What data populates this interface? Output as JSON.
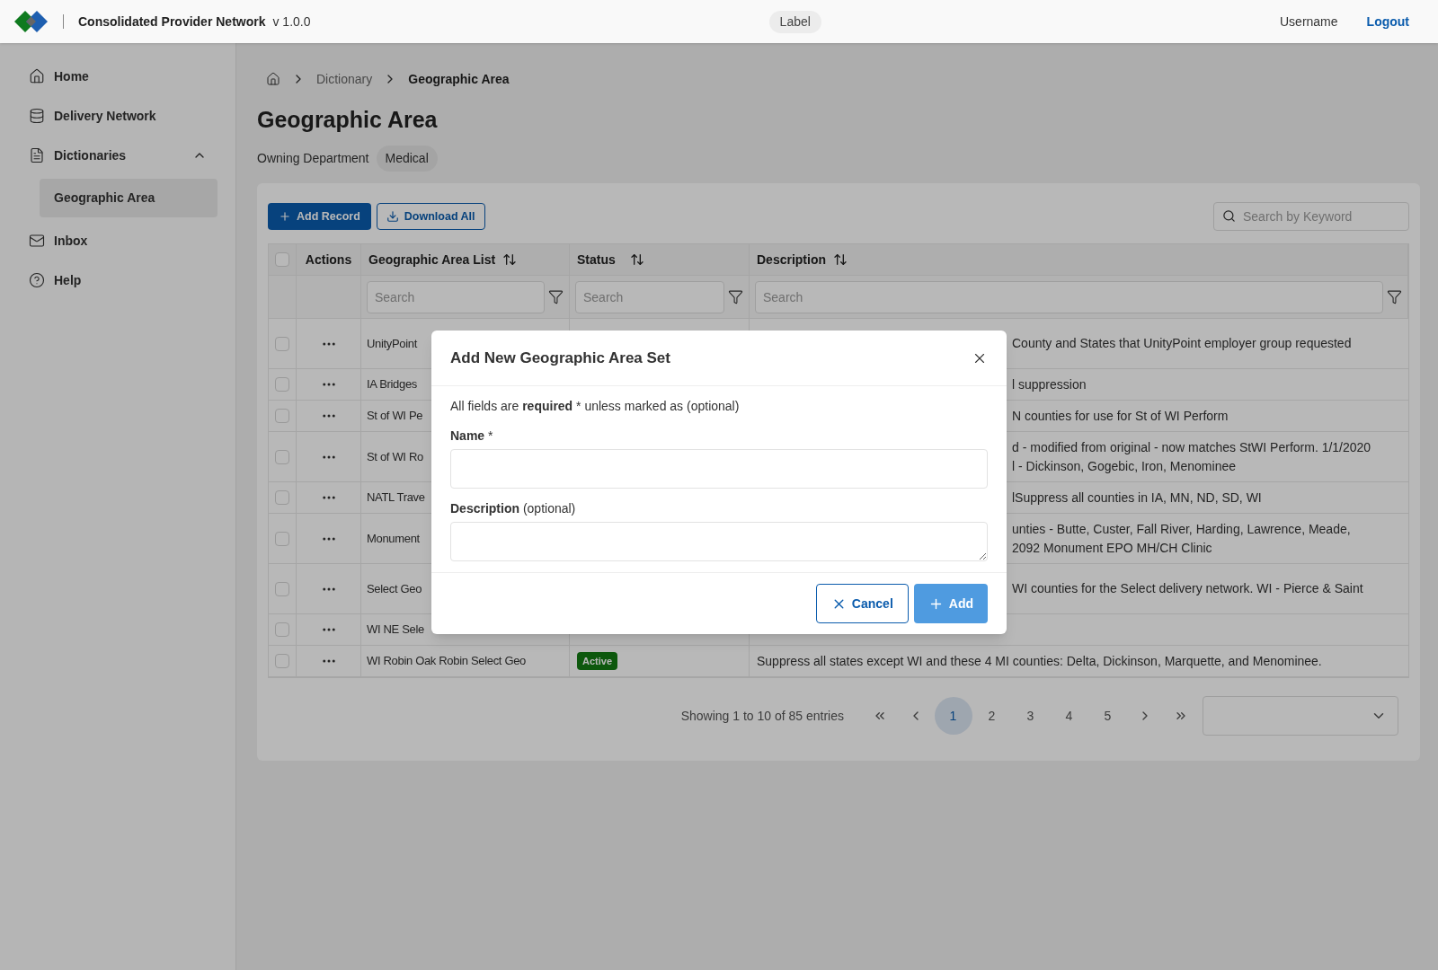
{
  "header": {
    "title": "Consolidated Provider Network",
    "version": "v 1.0.0",
    "label": "Label",
    "username": "Username",
    "logout": "Logout"
  },
  "sidebar": {
    "items": [
      {
        "label": "Home",
        "selected": false
      },
      {
        "label": "Delivery Network",
        "selected": false
      },
      {
        "label": "Dictionaries",
        "selected": false,
        "expanded": true,
        "children": [
          {
            "label": "Geographic Area",
            "selected": true
          }
        ]
      },
      {
        "label": "Inbox",
        "selected": false
      },
      {
        "label": "Help",
        "selected": false
      }
    ]
  },
  "breadcrumb": [
    "Dictionary",
    "Geographic Area"
  ],
  "page": {
    "title": "Geographic Area",
    "department_label": "Owning Department",
    "department": "Medical"
  },
  "toolbar": {
    "add": "Add Record",
    "download": "Download All",
    "search_placeholder": "Search by Keyword"
  },
  "table": {
    "all_checked": false,
    "columns": [
      {
        "label": "Actions",
        "sortable": false
      },
      {
        "label": "Geographic Area List",
        "sortable": true
      },
      {
        "label": "Status",
        "sortable": true
      },
      {
        "label": "Description",
        "sortable": true
      }
    ],
    "filter_placeholders": [
      "Search",
      "Search",
      "Search"
    ],
    "rows": [
      {
        "checked": false,
        "name": "UnityPoint",
        "clipped": true,
        "tall": true,
        "description": [
          "County and States that UnityPoint employer group requested"
        ]
      },
      {
        "checked": false,
        "name": "IA Bridges",
        "clipped": true,
        "description": [
          "l suppression"
        ]
      },
      {
        "checked": false,
        "name": "St of WI Pe",
        "clipped": true,
        "description": [
          "N counties for use for St of WI Perform"
        ]
      },
      {
        "checked": false,
        "name": "St of WI Ro",
        "clipped": true,
        "description": [
          "d - modified from original - now matches StWI Perform. 1/1/2020",
          "l - Dickinson, Gogebic, Iron, Menominee"
        ]
      },
      {
        "checked": false,
        "name": "NATL Trave",
        "clipped": true,
        "description": [
          "lSuppress all counties in IA, MN, ND, SD, WI"
        ]
      },
      {
        "checked": false,
        "name": "Monument",
        "clipped": true,
        "description": [
          "unties - Butte, Custer, Fall River, Harding, Lawrence, Meade,",
          "2092 Monument EPO MH/CH Clinic"
        ]
      },
      {
        "checked": false,
        "name": "Select Geo",
        "clipped": true,
        "tall": true,
        "description": [
          "WI counties for the Select delivery network. WI - Pierce & Saint"
        ]
      },
      {
        "checked": false,
        "name": "WI NE Sele",
        "description": []
      },
      {
        "checked": false,
        "name": "WI Robin Oak Robin Select Geo",
        "clipped": false,
        "status": "Active",
        "description": [
          "Suppress all states except WI and these 4 MI counties: Delta, Dickinson, Marquette, and Menominee."
        ]
      }
    ]
  },
  "pagination": {
    "summary": "Showing 1 to 10 of 85 entries",
    "pages": [
      {
        "label": "1",
        "selected": true
      },
      {
        "label": "2",
        "selected": false
      },
      {
        "label": "3",
        "selected": false
      },
      {
        "label": "4",
        "selected": false
      },
      {
        "label": "5",
        "selected": false
      }
    ]
  },
  "modal": {
    "title": "Add New Geographic Area Set",
    "note": "All fields are **required** * unless marked as (optional)",
    "fields": [
      {
        "kind": "input",
        "label": "Name",
        "suffix": "*"
      },
      {
        "kind": "textarea",
        "label": "Description",
        "suffix": "(optional)"
      }
    ],
    "buttons": [
      {
        "kind": "secondary",
        "label": "Cancel"
      },
      {
        "kind": "primary",
        "label": "Add"
      }
    ]
  }
}
